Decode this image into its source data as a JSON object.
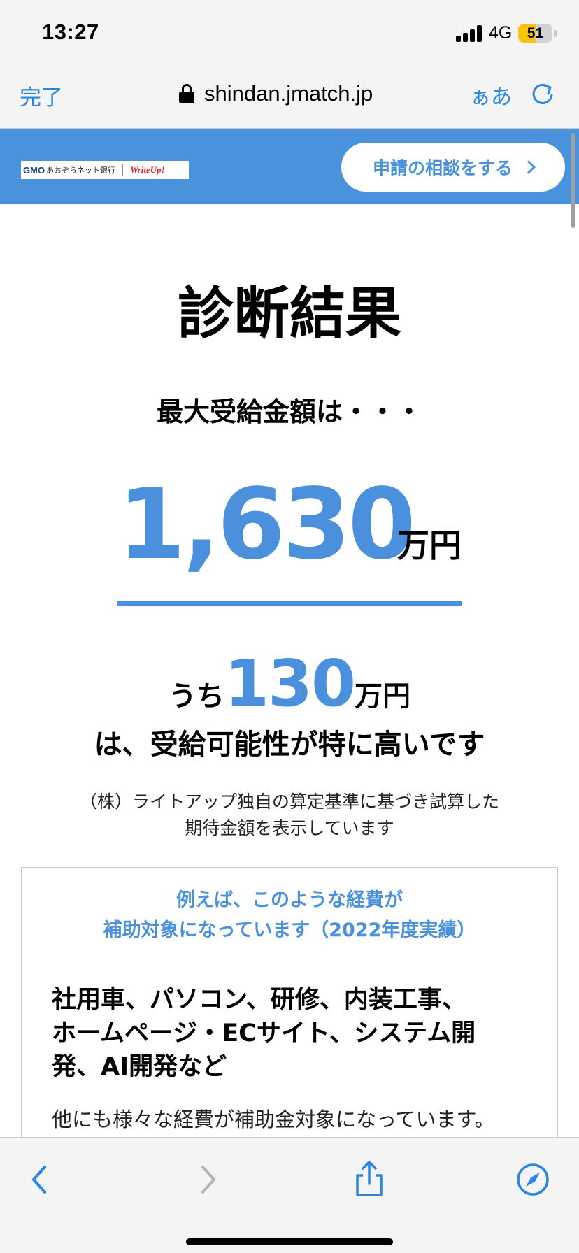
{
  "status_bar": {
    "time": "13:27",
    "network": "4G",
    "battery": "51",
    "battery_level": 0.51,
    "battery_color": "#fcc409"
  },
  "browser": {
    "done_label": "完了",
    "url": "shindan.jmatch.jp",
    "text_size_label": "ぁあ",
    "accent_color": "#2a86e3",
    "icons": [
      "lock-icon",
      "reload-icon",
      "back-icon",
      "forward-icon",
      "share-icon",
      "compass-icon"
    ]
  },
  "site_header": {
    "logo_gmo": "GMO",
    "logo_bank": "あおぞらネット銀行",
    "logo_write": "WriteUp!",
    "consult_button": "申請の相談をする",
    "brand_color": "#4b92dd"
  },
  "result": {
    "title": "診断結果",
    "max_label": "最大受給金額は・・・",
    "amount": "1,630",
    "amount_unit": "万円",
    "sub_prefix": "うち",
    "sub_amount": "130",
    "sub_unit": "万円",
    "sub_caption": "は、受給可能性が特に高いです",
    "note_line1": "（株）ライトアップ独自の算定基準に基づき試算した",
    "note_line2": "期待金額を表示しています"
  },
  "example": {
    "head_line1": "例えば、このような経費が",
    "head_line2": "補助対象になっています（2022年度実績）",
    "items_line1": "社用車、パソコン、研修、内装工事、",
    "items_line2": "ホームページ・ECサイト、システム開",
    "items_line3": "発、AI開発など",
    "more": "他にも様々な経費が補助金対象になっています。"
  }
}
